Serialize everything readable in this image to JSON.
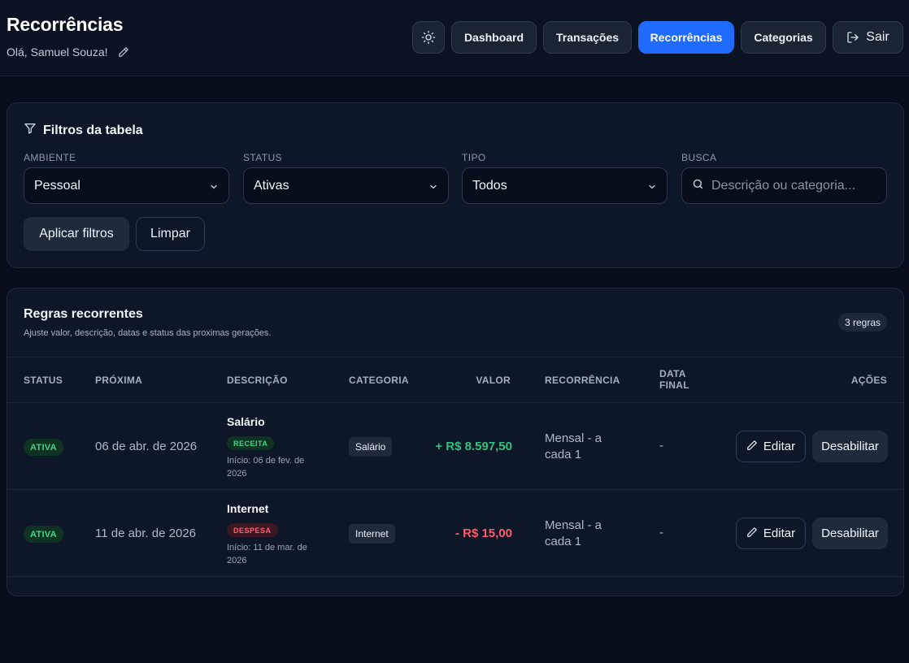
{
  "header": {
    "title": "Recorrências",
    "greeting": "Olá, Samuel Souza!",
    "nav": {
      "dashboard": "Dashboard",
      "transacoes": "Transações",
      "recorrencias": "Recorrências",
      "categorias": "Categorias",
      "sair": "Sair"
    },
    "active_nav": "Recorrências",
    "accent_color": "#1f6bff"
  },
  "filters": {
    "title": "Filtros da tabela",
    "ambiente": {
      "label": "AMBIENTE",
      "value": "Pessoal"
    },
    "status": {
      "label": "STATUS",
      "value": "Ativas"
    },
    "tipo": {
      "label": "TIPO",
      "value": "Todos"
    },
    "busca": {
      "label": "BUSCA",
      "placeholder": "Descrição ou categoria..."
    },
    "apply_label": "Aplicar filtros",
    "clear_label": "Limpar"
  },
  "rules": {
    "title": "Regras recorrentes",
    "subtitle": "Ajuste valor, descrição, datas e status das proximas gerações.",
    "count": "3 regras",
    "columns": {
      "status": "STATUS",
      "proxima": "PRÓXIMA",
      "descricao": "DESCRIÇÃO",
      "categoria": "CATEGORIA",
      "valor": "VALOR",
      "recorrencia": "RECORRÊNCIA",
      "data_final": "DATA FINAL",
      "acoes": "AÇÕES"
    },
    "rows": [
      {
        "status": "ATIVA",
        "proxima": "06 de abr. de 2026",
        "descricao": "Salário",
        "tipo": "RECEITA",
        "inicio": "Início: 06 de fev. de 2026",
        "categoria": "Salário",
        "valor": "+ R$ 8.597,50",
        "recorrencia": "Mensal - a cada 1",
        "data_final": "-",
        "edit_label": "Editar",
        "disable_label": "Desabilitar"
      },
      {
        "status": "ATIVA",
        "proxima": "11 de abr. de 2026",
        "descricao": "Internet",
        "tipo": "DESPESA",
        "inicio": "Início: 11 de mar. de 2026",
        "categoria": "Internet",
        "valor": "- R$ 15,00",
        "recorrencia": "Mensal - a cada 1",
        "data_final": "-",
        "edit_label": "Editar",
        "disable_label": "Desabilitar"
      }
    ]
  },
  "colors": {
    "positive": "#2ec27e",
    "negative": "#ff5a6e",
    "background": "#070d1a"
  }
}
